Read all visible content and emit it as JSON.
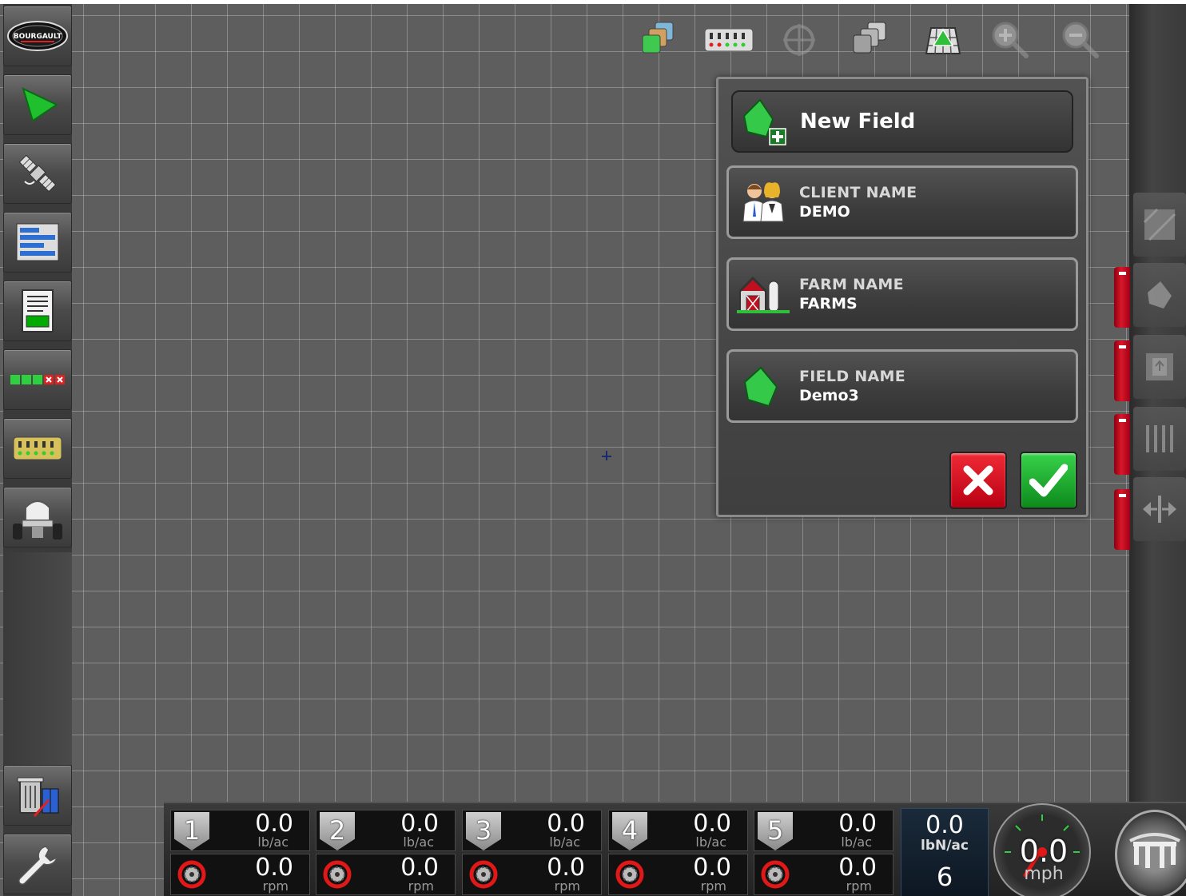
{
  "app": {
    "brand": "BOURGAULT"
  },
  "left_sidebar": {
    "items": [
      {
        "name": "logo",
        "icon": "bourgault-logo-icon"
      },
      {
        "name": "guidance",
        "icon": "guidance-arrow-icon"
      },
      {
        "name": "gps",
        "icon": "satellite-icon"
      },
      {
        "name": "layers",
        "icon": "list-bars-icon"
      },
      {
        "name": "report",
        "icon": "report-icon"
      },
      {
        "name": "sections",
        "icon": "section-status-icon"
      },
      {
        "name": "seeder",
        "icon": "seeder-icon"
      },
      {
        "name": "implement",
        "icon": "air-cart-icon"
      },
      {
        "name": "delete",
        "icon": "trash-icon"
      },
      {
        "name": "settings",
        "icon": "wrench-icon"
      }
    ]
  },
  "toolbar": {
    "icons": [
      "layers-icon",
      "seeder-rows-icon",
      "gps-target-icon",
      "stack-icon",
      "field-view-icon",
      "zoom-in-icon",
      "zoom-out-icon"
    ]
  },
  "dialog": {
    "title": "New Field",
    "rows": [
      {
        "label": "CLIENT NAME",
        "value": "DEMO",
        "icon": "client-people-icon"
      },
      {
        "label": "FARM NAME",
        "value": "FARMS",
        "icon": "barn-icon"
      },
      {
        "label": "FIELD NAME",
        "value": "Demo3",
        "icon": "field-shape-icon"
      }
    ],
    "cancel_icon": "close-icon",
    "confirm_icon": "checkmark-icon",
    "colors": {
      "cancel": "#d9182b",
      "confirm": "#1fae30",
      "field": "#35c94a"
    }
  },
  "bottom_bar": {
    "sections": [
      {
        "num": "1",
        "rate": "0.0",
        "rate_unit": "lb/ac",
        "rpm": "0.0",
        "rpm_unit": "rpm"
      },
      {
        "num": "2",
        "rate": "0.0",
        "rate_unit": "lb/ac",
        "rpm": "0.0",
        "rpm_unit": "rpm"
      },
      {
        "num": "3",
        "rate": "0.0",
        "rate_unit": "lb/ac",
        "rpm": "0.0",
        "rpm_unit": "rpm"
      },
      {
        "num": "4",
        "rate": "0.0",
        "rate_unit": "lb/ac",
        "rpm": "0.0",
        "rpm_unit": "rpm"
      },
      {
        "num": "5",
        "rate": "0.0",
        "rate_unit": "lb/ac",
        "rpm": "0.0",
        "rpm_unit": "rpm"
      }
    ],
    "nitrogen": {
      "value": "0.0",
      "unit": "lbN/ac",
      "count": "6"
    },
    "speed": {
      "value": "0.0",
      "unit": "mph"
    }
  }
}
